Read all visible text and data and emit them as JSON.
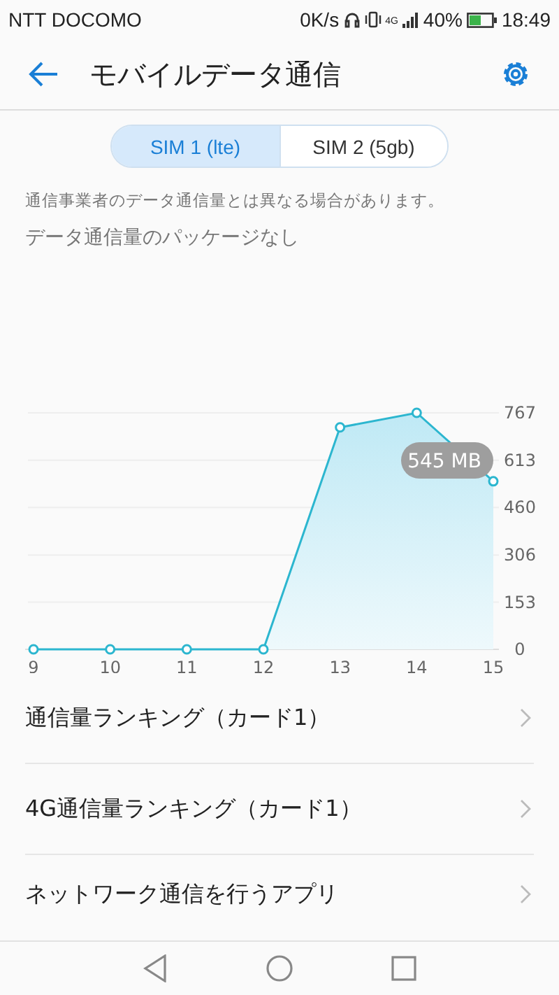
{
  "status_bar": {
    "carrier": "NTT DOCOMO",
    "speed": "0K/s",
    "network": "4G",
    "battery": "40%",
    "time": "18:49"
  },
  "header": {
    "title": "モバイルデータ通信"
  },
  "sim_tabs": [
    {
      "label": "SIM 1 (lte)",
      "selected": true
    },
    {
      "label": "SIM 2 (5gb)",
      "selected": false
    }
  ],
  "note": "通信事業者のデータ通信量とは異なる場合があります。",
  "package": "データ通信量のパッケージなし",
  "usage": {
    "chart_data": {
      "type": "area",
      "x": [
        9,
        10,
        11,
        12,
        13,
        14,
        15
      ],
      "series": [
        {
          "color": "#2cb6cf",
          "values": [
            0,
            0,
            0,
            0,
            720,
            767,
            545
          ]
        }
      ],
      "xlim": [
        9,
        15
      ],
      "ylim": [
        0,
        767
      ],
      "grid": true,
      "yticks": [
        0,
        153,
        306,
        460,
        613,
        767
      ],
      "xticks": [
        9,
        10,
        11,
        12,
        13,
        14,
        15
      ],
      "annotations": [
        "545 MB"
      ]
    }
  },
  "menu": [
    {
      "label": "通信量ランキング（カード1）"
    },
    {
      "label": "4G通信量ランキング（カード1）"
    },
    {
      "label": "ネットワーク通信を行うアプリ"
    }
  ]
}
